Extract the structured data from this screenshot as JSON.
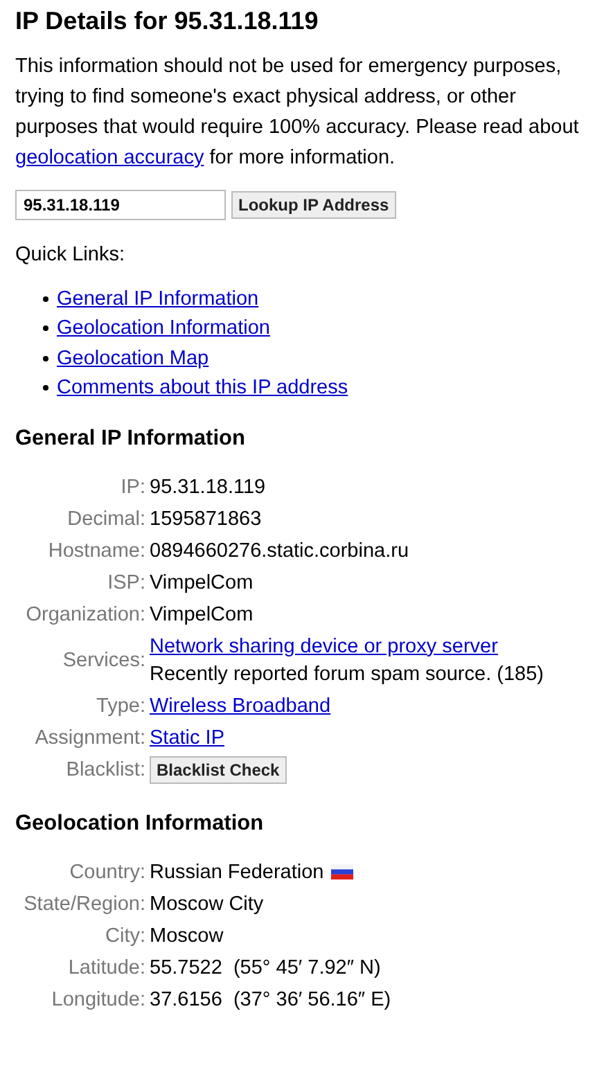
{
  "title": "IP Details for 95.31.18.119",
  "notice_before": "This information should not be used for emergency purposes, trying to find someone's exact physical address, or other purposes that would require 100% accuracy. Please read about ",
  "notice_link": "geolocation accuracy",
  "notice_after": " for more information.",
  "lookup": {
    "value": "95.31.18.119",
    "button": "Lookup IP Address"
  },
  "quick_links_label": "Quick Links:",
  "quick_links": [
    "General IP Information",
    "Geolocation Information",
    "Geolocation Map",
    "Comments about this IP address"
  ],
  "sections": [
    {
      "heading": "General IP Information",
      "rows": [
        {
          "label": "IP:",
          "parts": [
            {
              "kind": "text",
              "text": "95.31.18.119"
            }
          ]
        },
        {
          "label": "Decimal:",
          "parts": [
            {
              "kind": "text",
              "text": "1595871863"
            }
          ]
        },
        {
          "label": "Hostname:",
          "parts": [
            {
              "kind": "text",
              "text": "0894660276.static.corbina.ru"
            }
          ]
        },
        {
          "label": "ISP:",
          "parts": [
            {
              "kind": "text",
              "text": "VimpelCom"
            }
          ]
        },
        {
          "label": "Organization:",
          "parts": [
            {
              "kind": "text",
              "text": "VimpelCom"
            }
          ]
        },
        {
          "label": "Services:",
          "parts": [
            {
              "kind": "link",
              "text": "Network sharing device or proxy server"
            },
            {
              "kind": "text",
              "text": "Recently reported forum spam source. (185)"
            }
          ]
        },
        {
          "label": "Type:",
          "parts": [
            {
              "kind": "link",
              "text": "Wireless Broadband"
            }
          ]
        },
        {
          "label": "Assignment:",
          "parts": [
            {
              "kind": "link",
              "text": "Static IP"
            }
          ]
        },
        {
          "label": "Blacklist:",
          "parts": [
            {
              "kind": "button",
              "text": "Blacklist Check"
            }
          ]
        }
      ]
    },
    {
      "heading": "Geolocation Information",
      "rows": [
        {
          "label": "Country:",
          "parts": [
            {
              "kind": "text",
              "text": "Russian Federation"
            },
            {
              "kind": "flag"
            }
          ]
        },
        {
          "label": "State/Region:",
          "parts": [
            {
              "kind": "text",
              "text": "Moscow City"
            }
          ]
        },
        {
          "label": "City:",
          "parts": [
            {
              "kind": "text",
              "text": "Moscow"
            }
          ]
        },
        {
          "label": "Latitude:",
          "parts": [
            {
              "kind": "text",
              "text": "55.7522  (55° 45′ 7.92″ N)"
            }
          ]
        },
        {
          "label": "Longitude:",
          "parts": [
            {
              "kind": "text",
              "text": "37.6156  (37° 36′ 56.16″ E)"
            }
          ]
        }
      ]
    }
  ]
}
